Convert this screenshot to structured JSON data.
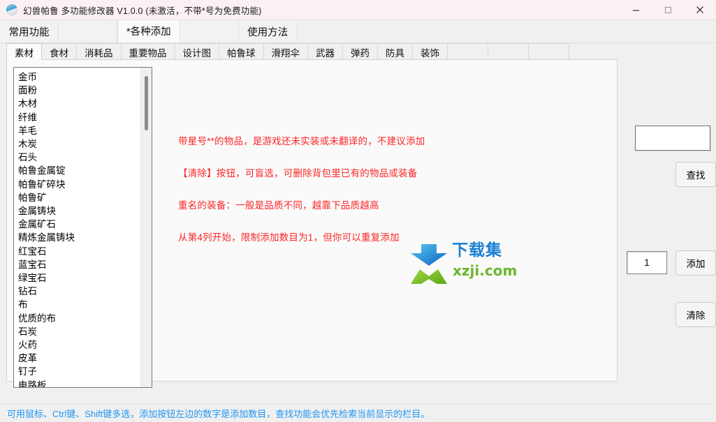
{
  "window": {
    "title": "幻兽帕鲁 多功能修改器  V1.0.0  (未激活，不带*号为免费功能)",
    "icon": "app-logo-icon",
    "minimize_label": "—",
    "maximize_label": "□",
    "close_label": "✕"
  },
  "main_tabs": [
    {
      "label": "常用功能",
      "selected": false
    },
    {
      "label": "",
      "selected": false
    },
    {
      "label": "*各种添加",
      "selected": true
    },
    {
      "label": "",
      "selected": false
    },
    {
      "label": "使用方法",
      "selected": false
    }
  ],
  "sub_tabs": [
    {
      "label": "素材",
      "selected": true
    },
    {
      "label": "食材",
      "selected": false
    },
    {
      "label": "消耗品",
      "selected": false
    },
    {
      "label": "重要物品",
      "selected": false
    },
    {
      "label": "设计图",
      "selected": false
    },
    {
      "label": "帕鲁球",
      "selected": false
    },
    {
      "label": "滑翔伞",
      "selected": false
    },
    {
      "label": "武器",
      "selected": false
    },
    {
      "label": "弹药",
      "selected": false
    },
    {
      "label": "防具",
      "selected": false
    },
    {
      "label": "装饰",
      "selected": false
    },
    {
      "label": "",
      "selected": false
    },
    {
      "label": "",
      "selected": false
    },
    {
      "label": "",
      "selected": false
    }
  ],
  "item_list": [
    "金币",
    "面粉",
    "木材",
    "纤维",
    "羊毛",
    "木炭",
    "石头",
    "帕鲁金属锭",
    "帕鲁矿碎块",
    "帕鲁矿",
    "金属铸块",
    "金属矿石",
    "精炼金属铸块",
    "红宝石",
    "蓝宝石",
    "绿宝石",
    "钻石",
    "布",
    "优质的布",
    "石炭",
    "火药",
    "皮革",
    "钉子",
    "电路板"
  ],
  "notes": [
    "带星号**的物品，是游戏还未实装或未翻译的，不建议添加",
    "【清除】按钮，可盲选，可删除背包里已有的物品或装备",
    "重名的装备：一般是品质不同，越靠下品质越高",
    "从第4列开始，限制添加数目为1，但你可以重复添加"
  ],
  "watermark": {
    "text_top": "下载集",
    "text_bottom": "xzji.com"
  },
  "right_panel": {
    "search_value": "",
    "search_placeholder": "",
    "find_label": "查找",
    "quantity_value": "1",
    "add_label": "添加",
    "clear_label": "清除"
  },
  "status_bar": {
    "text": "可用鼠标、Ctrl键、Shift键多选，添加按钮左边的数字是添加数目，查找功能会优先检索当前显示的栏目。"
  },
  "colors": {
    "note_red": "#fc2626",
    "status_blue": "#2196f3",
    "watermark_blue": "#1b7fd4",
    "watermark_green": "#6cb52d"
  }
}
